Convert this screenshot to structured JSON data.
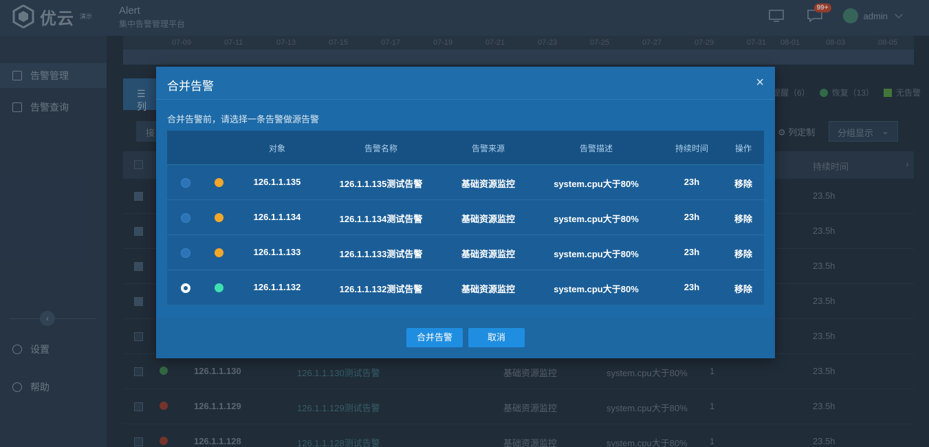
{
  "topbar": {
    "logo_text": "优云",
    "logo_badge": "演示",
    "app_title": "Alert",
    "app_subtitle": "集中告警管理平台",
    "notif_count": "99+",
    "username": "admin"
  },
  "sidebar": {
    "items": [
      {
        "label": "告警管理"
      },
      {
        "label": "告警查询"
      },
      {
        "label": "设置"
      },
      {
        "label": "帮助"
      }
    ]
  },
  "timeline": {
    "labels": [
      "07-09",
      "07-11",
      "07-13",
      "07-15",
      "07-17",
      "07-19",
      "07-21",
      "07-23",
      "07-25",
      "07-27",
      "07-29",
      "07-31",
      "08-01",
      "08-03",
      "08-05"
    ]
  },
  "background": {
    "tab_label": "列",
    "legend_text1": "提醒（6）",
    "legend_text2": "恢复（13）",
    "legend_text3": "无告警",
    "btn_left": "接",
    "btn_columns": "列定制",
    "btn_group": "分组显示",
    "header_duration": "持续时间",
    "rows": [
      {
        "duration": "23.5h"
      },
      {
        "duration": "23.5h"
      },
      {
        "duration": "23.5h"
      },
      {
        "duration": "23.5h"
      },
      {
        "duration": "23.5h"
      },
      {
        "obj": "126.1.1.130",
        "name": "126.1.1.130测试告警",
        "source": "基础资源监控",
        "desc": "system.cpu大于80%",
        "count": "1",
        "duration": "23.5h",
        "color": "#3b7a4a"
      },
      {
        "obj": "126.1.1.129",
        "name": "126.1.1.129测试告警",
        "source": "基础资源监控",
        "desc": "system.cpu大于80%",
        "count": "1",
        "duration": "23.5h",
        "color": "#8a3a2e"
      },
      {
        "obj": "126.1.1.128",
        "name": "126.1.1.128测试告警",
        "source": "基础资源监控",
        "desc": "system.cpu大于80%",
        "count": "1",
        "duration": "23.5h",
        "color": "#8a3a2e"
      }
    ]
  },
  "modal": {
    "title": "合并告警",
    "close_glyph": "×",
    "tip": "合并告警前，请选择一条告警做源告警",
    "columns": [
      "对象",
      "告警名称",
      "告警来源",
      "告警描述",
      "持续时间",
      "操作"
    ],
    "rows": [
      {
        "object": "126.1.1.135",
        "name": "126.1.1.135测试告警",
        "source": "基础资源监控",
        "desc": "system.cpu大于80%",
        "duration": "23h",
        "action": "移除",
        "selected": false,
        "status_color": "#f2a72c"
      },
      {
        "object": "126.1.1.134",
        "name": "126.1.1.134测试告警",
        "source": "基础资源监控",
        "desc": "system.cpu大于80%",
        "duration": "23h",
        "action": "移除",
        "selected": false,
        "status_color": "#f2a72c"
      },
      {
        "object": "126.1.1.133",
        "name": "126.1.1.133测试告警",
        "source": "基础资源监控",
        "desc": "system.cpu大于80%",
        "duration": "23h",
        "action": "移除",
        "selected": false,
        "status_color": "#f2a72c"
      },
      {
        "object": "126.1.1.132",
        "name": "126.1.1.132测试告警",
        "source": "基础资源监控",
        "desc": "system.cpu大于80%",
        "duration": "23h",
        "action": "移除",
        "selected": true,
        "status_color": "#3fe0b0"
      }
    ],
    "btn_merge": "合并告警",
    "btn_cancel": "取消"
  }
}
